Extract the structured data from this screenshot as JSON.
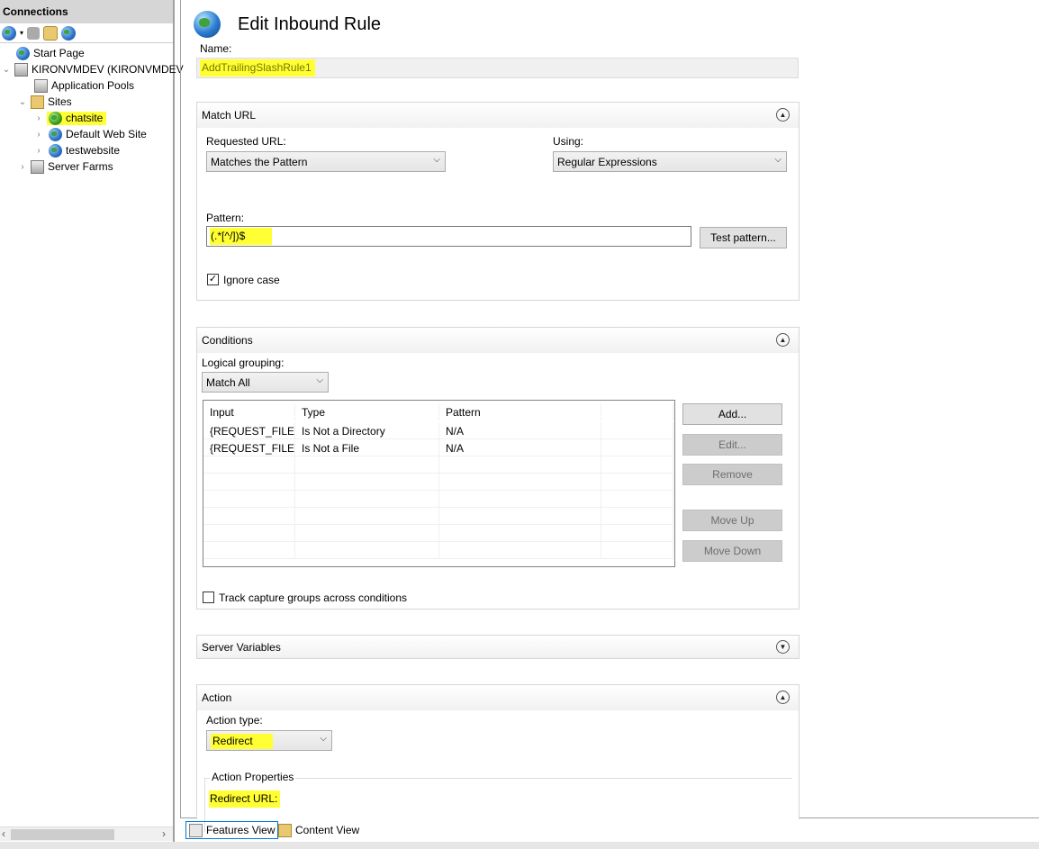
{
  "connections": {
    "title": "Connections",
    "toolbar": [
      "connect-icon",
      "save-icon",
      "folder-up-icon",
      "disconnect-icon"
    ],
    "tree": [
      {
        "label": "Start Page",
        "icon": "start-page-icon"
      },
      {
        "label": "KIRONVMDEV (KIRONVMDEV",
        "icon": "server-icon"
      },
      {
        "label": "Application Pools",
        "icon": "app-pools-icon"
      },
      {
        "label": "Sites",
        "icon": "sites-folder-icon"
      },
      {
        "label": "chatsite",
        "icon": "globe-icon",
        "selected": true
      },
      {
        "label": "Default Web Site",
        "icon": "globe-icon"
      },
      {
        "label": "testwebsite",
        "icon": "globe-icon"
      },
      {
        "label": "Server Farms",
        "icon": "server-farms-icon"
      }
    ]
  },
  "main": {
    "title": "Edit Inbound Rule",
    "name_label": "Name:",
    "name_value": "AddTrailingSlashRule1",
    "match_url": {
      "header": "Match URL",
      "requested_url_label": "Requested URL:",
      "requested_url_value": "Matches the Pattern",
      "using_label": "Using:",
      "using_value": "Regular Expressions",
      "pattern_label": "Pattern:",
      "pattern_value": "(.*[^/])$",
      "test_pattern": "Test pattern...",
      "ignore_case_label": "Ignore case",
      "ignore_case": true
    },
    "conditions": {
      "header": "Conditions",
      "logical_grouping_label": "Logical grouping:",
      "logical_grouping_value": "Match All",
      "columns": [
        "Input",
        "Type",
        "Pattern"
      ],
      "rows": [
        [
          "{REQUEST_FILE...",
          "Is Not a Directory",
          "N/A"
        ],
        [
          "{REQUEST_FILE...",
          "Is Not a File",
          "N/A"
        ]
      ],
      "buttons": {
        "add": "Add...",
        "edit": "Edit...",
        "remove": "Remove",
        "move_up": "Move Up",
        "move_down": "Move Down"
      },
      "track_label": "Track capture groups across conditions",
      "track": false
    },
    "server_variables": {
      "header": "Server Variables"
    },
    "action": {
      "header": "Action",
      "action_type_label": "Action type:",
      "action_type_value": "Redirect",
      "properties_label": "Action Properties",
      "redirect_url_label": "Redirect URL:"
    }
  },
  "bottom_tabs": {
    "features_view": "Features View",
    "content_view": "Content View"
  },
  "colors": {
    "highlight": "#ffff33",
    "accent": "#0078d7"
  }
}
